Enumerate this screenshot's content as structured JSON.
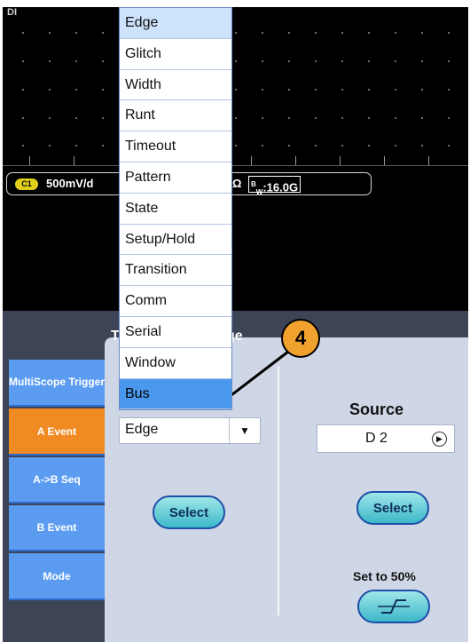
{
  "scope": {
    "corner_label": "DI",
    "channel": {
      "badge": "C1",
      "scale": "500mV/d",
      "unit_fragment": "Ω",
      "bandwidth_prefix": "B",
      "bandwidth_sub": "W",
      "bandwidth_value": ":16.0G"
    }
  },
  "trigger_panel": {
    "title_fragment_left": "T",
    "title_fragment": "ge",
    "tabs": [
      {
        "label": "MultiScope Trigger"
      },
      {
        "label": "A Event"
      },
      {
        "label": "A->B Seq"
      },
      {
        "label": "B Event"
      },
      {
        "label": "Mode"
      }
    ],
    "type": {
      "label_fragment": "e",
      "value": "Edge",
      "arrow": "▼",
      "select_label": "Select"
    },
    "source": {
      "label": "Source",
      "value": "D 2",
      "arrow": "▶",
      "select_label": "Select"
    },
    "set50": {
      "label": "Set to 50%",
      "icon": "rising-edge-icon"
    }
  },
  "type_menu": {
    "items": [
      "Edge",
      "Glitch",
      "Width",
      "Runt",
      "Timeout",
      "Pattern",
      "State",
      "Setup/Hold",
      "Transition",
      "Comm",
      "Serial",
      "Window",
      "Bus"
    ],
    "selected": "Edge",
    "highlighted": "Bus"
  },
  "callout": {
    "number": "4",
    "color": "#f0a12e"
  }
}
